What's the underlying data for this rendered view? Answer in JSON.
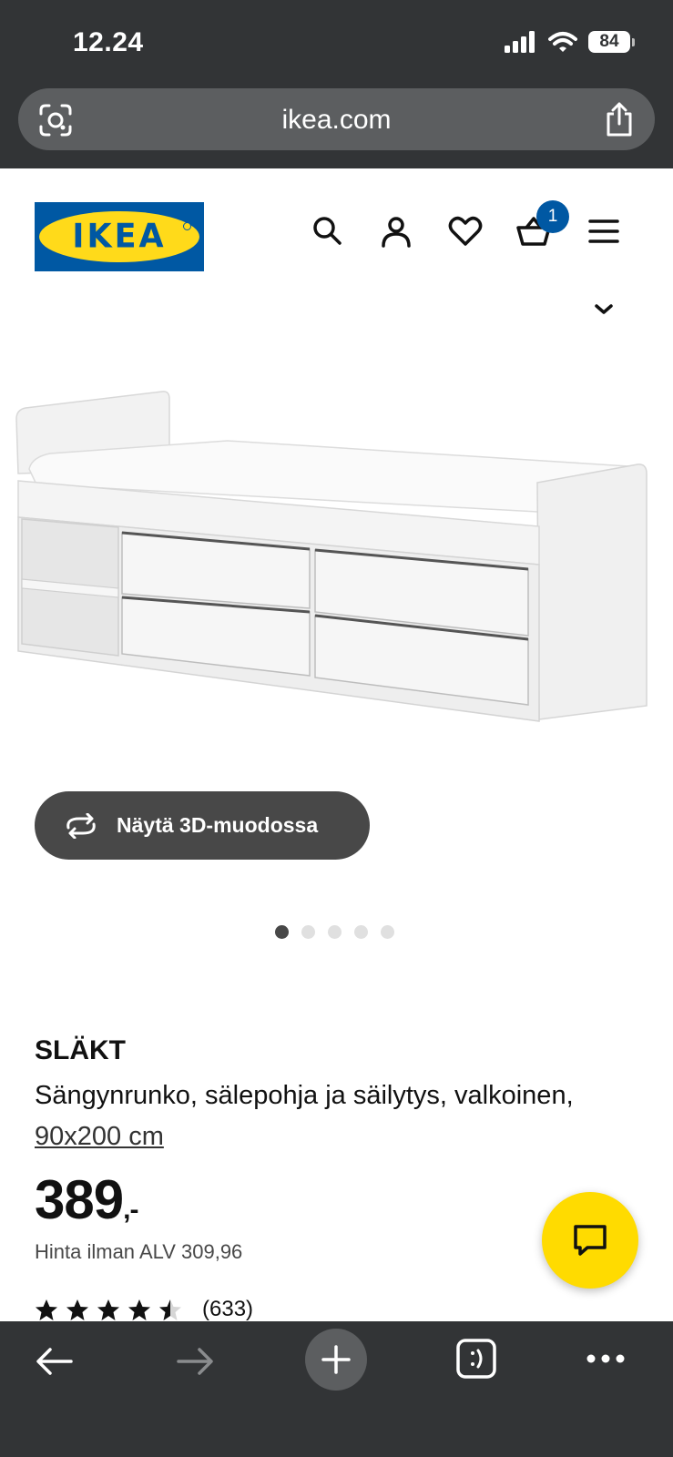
{
  "status_bar": {
    "time": "12.24",
    "battery": "84"
  },
  "browser": {
    "url": "ikea.com"
  },
  "header": {
    "logo_text": "IKEA",
    "cart_count": "1",
    "icons": [
      "search-icon",
      "account-icon",
      "heart-icon",
      "cart-icon",
      "menu-icon"
    ]
  },
  "gallery": {
    "view_3d_label": "Näytä 3D-muodossa",
    "slide_count": 5,
    "active_slide": 1
  },
  "product": {
    "name": "SLÄKT",
    "description": "Sängynrunko, sälepohja ja säilytys, valkoinen,",
    "size": "90x200 cm",
    "price": "389",
    "price_suffix": ",-",
    "price_excl_vat": "Hinta ilman ALV 309,96",
    "rating_value": 4.5,
    "rating_max": 5,
    "review_count": "(633)"
  },
  "colors": {
    "ikea_blue": "#0058a3",
    "ikea_yellow": "#ffda1a",
    "chrome_dark": "#323436",
    "button_dark": "#484848"
  }
}
